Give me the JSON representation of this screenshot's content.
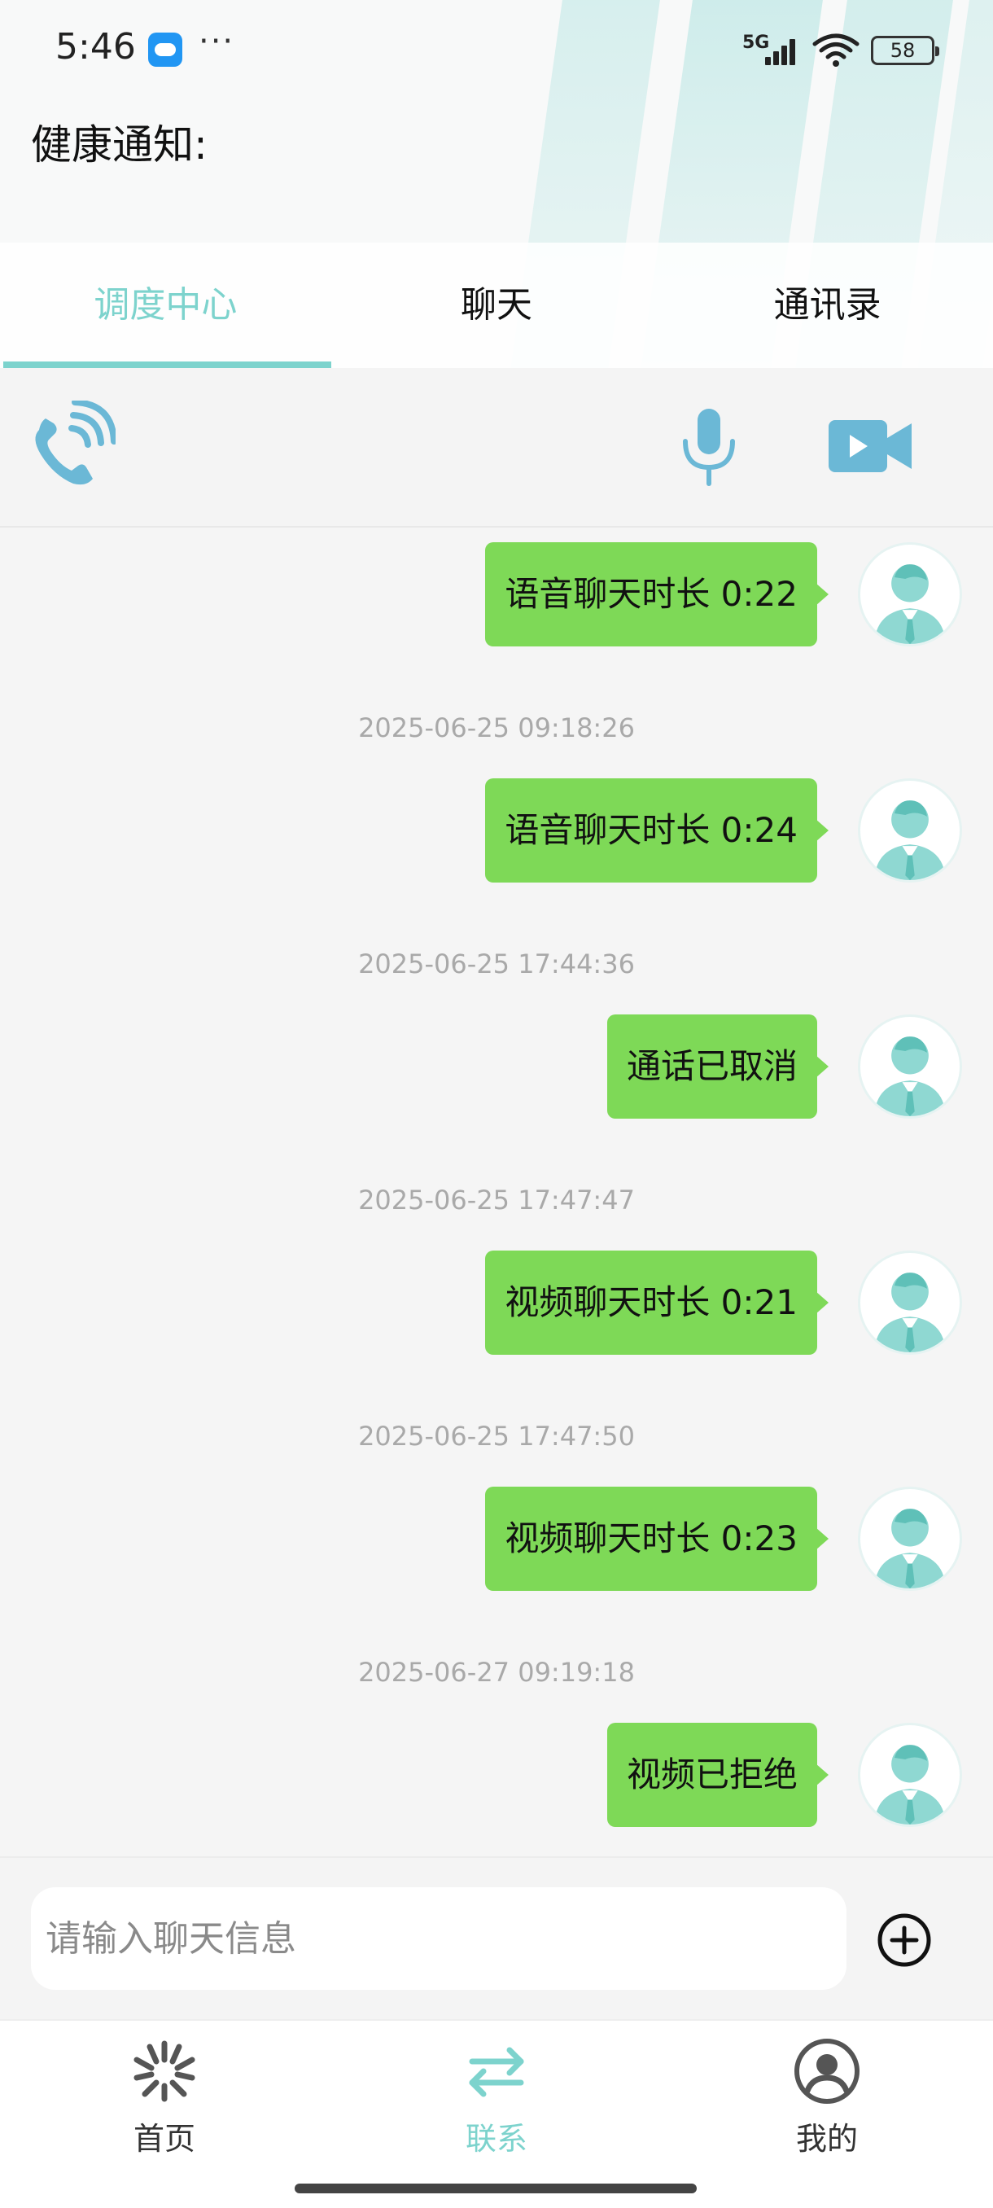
{
  "status_bar": {
    "time": "5:46",
    "more": "···",
    "network": "5G",
    "battery": "58"
  },
  "page": {
    "title": "健康通知:"
  },
  "tabs": [
    {
      "label": "调度中心",
      "active": true
    },
    {
      "label": "聊天",
      "active": false
    },
    {
      "label": "通讯录",
      "active": false
    }
  ],
  "toolbar": {
    "icons": [
      "phone-call-icon",
      "microphone-icon",
      "video-camera-icon"
    ]
  },
  "messages": [
    {
      "text": "语音聊天时长 0:22",
      "timestamp": null
    },
    {
      "text": "语音聊天时长 0:24",
      "timestamp": "2025-06-25 09:18:26"
    },
    {
      "text": "通话已取消",
      "timestamp": "2025-06-25 17:44:36"
    },
    {
      "text": "视频聊天时长 0:21",
      "timestamp": "2025-06-25 17:47:47"
    },
    {
      "text": "视频聊天时长 0:23",
      "timestamp": "2025-06-25 17:47:50"
    },
    {
      "text": "视频已拒绝",
      "timestamp": "2025-06-27 09:19:18"
    }
  ],
  "input": {
    "placeholder": "请输入聊天信息",
    "value": ""
  },
  "bottom_nav": [
    {
      "label": "首页",
      "icon": "home-burst-icon",
      "active": false
    },
    {
      "label": "联系",
      "icon": "exchange-arrows-icon",
      "active": true
    },
    {
      "label": "我的",
      "icon": "user-circle-icon",
      "active": false
    }
  ],
  "colors": {
    "accent": "#7dd3cd",
    "bubble": "#7ed957",
    "toolbar_icon": "#6bb8d6",
    "timestamp": "#a9a9a9"
  }
}
